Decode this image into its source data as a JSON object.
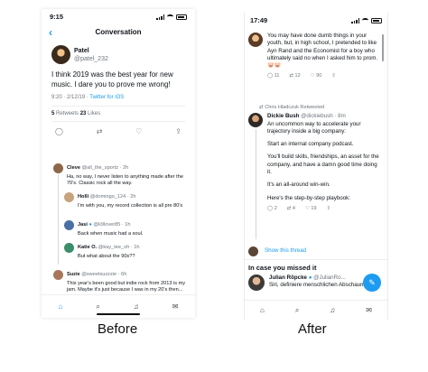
{
  "before": {
    "caption": "Before",
    "status": {
      "time": "9:15"
    },
    "header": {
      "title": "Conversation"
    },
    "main_tweet": {
      "name": "Patel",
      "handle": "@patel_232",
      "text": "I think 2019 was the best year for new music. I dare you to prove me wrong!",
      "time": "9:20 · 2/12/19 · ",
      "client": "Twitter for iOS",
      "retweets_count": "5",
      "retweets_label": " Retweets  ",
      "likes_count": "23",
      "likes_label": " Likes"
    },
    "replies": [
      {
        "name": "Cleve",
        "handle": "@all_the_sportz · 2h",
        "text": "Ha, no way, I never listen to anything made after the 70's. Classic rock all the way."
      },
      {
        "name": "Holli",
        "handle": "@domingo_124 · 2h",
        "text": "I'm with you, my record collection is all pre 80's"
      },
      {
        "name": "Jasi",
        "handle": "@k9lover85 · 1h",
        "text": "Back when music had a soul."
      },
      {
        "name": "Katie O.",
        "handle": "@kay_tee_oh · 1h",
        "text": "But what about the 90s??"
      },
      {
        "name": "Suzie",
        "handle": "@sweetsuzzzie · 6h",
        "text": "This year's been good but indie rock from 2013 is my jam. Maybe it's just because I was in my 20's then..."
      }
    ]
  },
  "after": {
    "caption": "After",
    "status": {
      "time": "17:49"
    },
    "top_tweet": {
      "text": "You may have done dumb things in your youth, but, in high school, I pretended to like Ayn Rand and the Economist for a boy who ultimately said no when I asked him to prom. 🐷🐷",
      "replies": "11",
      "retweets": "12",
      "likes": "90"
    },
    "retweet_tweet": {
      "retweeted_by": "Chris Hladczuk Retweeted",
      "name": "Dickie Bush",
      "handle": "@dickiebush · 8m",
      "paragraphs": [
        "An uncommon way to accelerate your trajectory inside a big company:",
        "Start an internal company podcast.",
        "You'll build skills, friendships, an asset for the company, and have a damn good time doing it.",
        "It's an all-around win-win.",
        "Here's the step-by-step playbook:"
      ],
      "replies": "2",
      "retweets": "4",
      "likes": "19"
    },
    "show_thread": "Show this thread",
    "section_title": "In case you missed it",
    "missed_tweet": {
      "name": "Julian Röpcke",
      "handle": "@JulianRo...",
      "text": "Siri, definiere menschlichen Abschaum."
    }
  }
}
